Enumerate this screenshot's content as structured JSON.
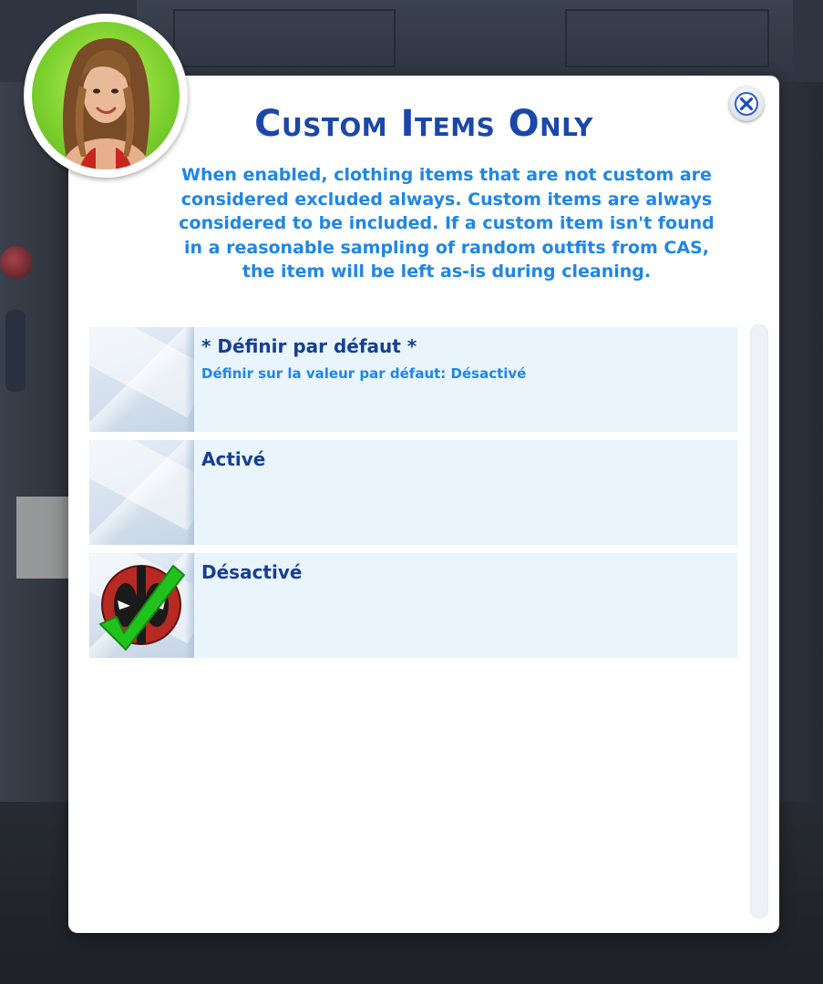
{
  "dialog": {
    "title": "Custom Items Only",
    "description": "When enabled, clothing items that are not custom are considered excluded always.  Custom items are always considered to be included.  If a custom item isn't found in a reasonable sampling of random outfits from CAS, the item will be left as-is during cleaning.",
    "close_icon": "close-icon",
    "avatar_icon": "sim-avatar"
  },
  "options": [
    {
      "label": "* Définir par défaut *",
      "sublabel": "Définir sur la valeur par défaut: Désactivé",
      "icon": "blank-thumbnail",
      "selected": false
    },
    {
      "label": "Activé",
      "sublabel": "",
      "icon": "blank-thumbnail",
      "selected": false
    },
    {
      "label": "Désactivé",
      "sublabel": "",
      "icon": "deadpool-checkmark-icon",
      "selected": true
    }
  ],
  "colors": {
    "title": "#1a47a9",
    "description": "#1e86e6",
    "row_background": "#e9f4fd",
    "check_green": "#22c21e"
  }
}
